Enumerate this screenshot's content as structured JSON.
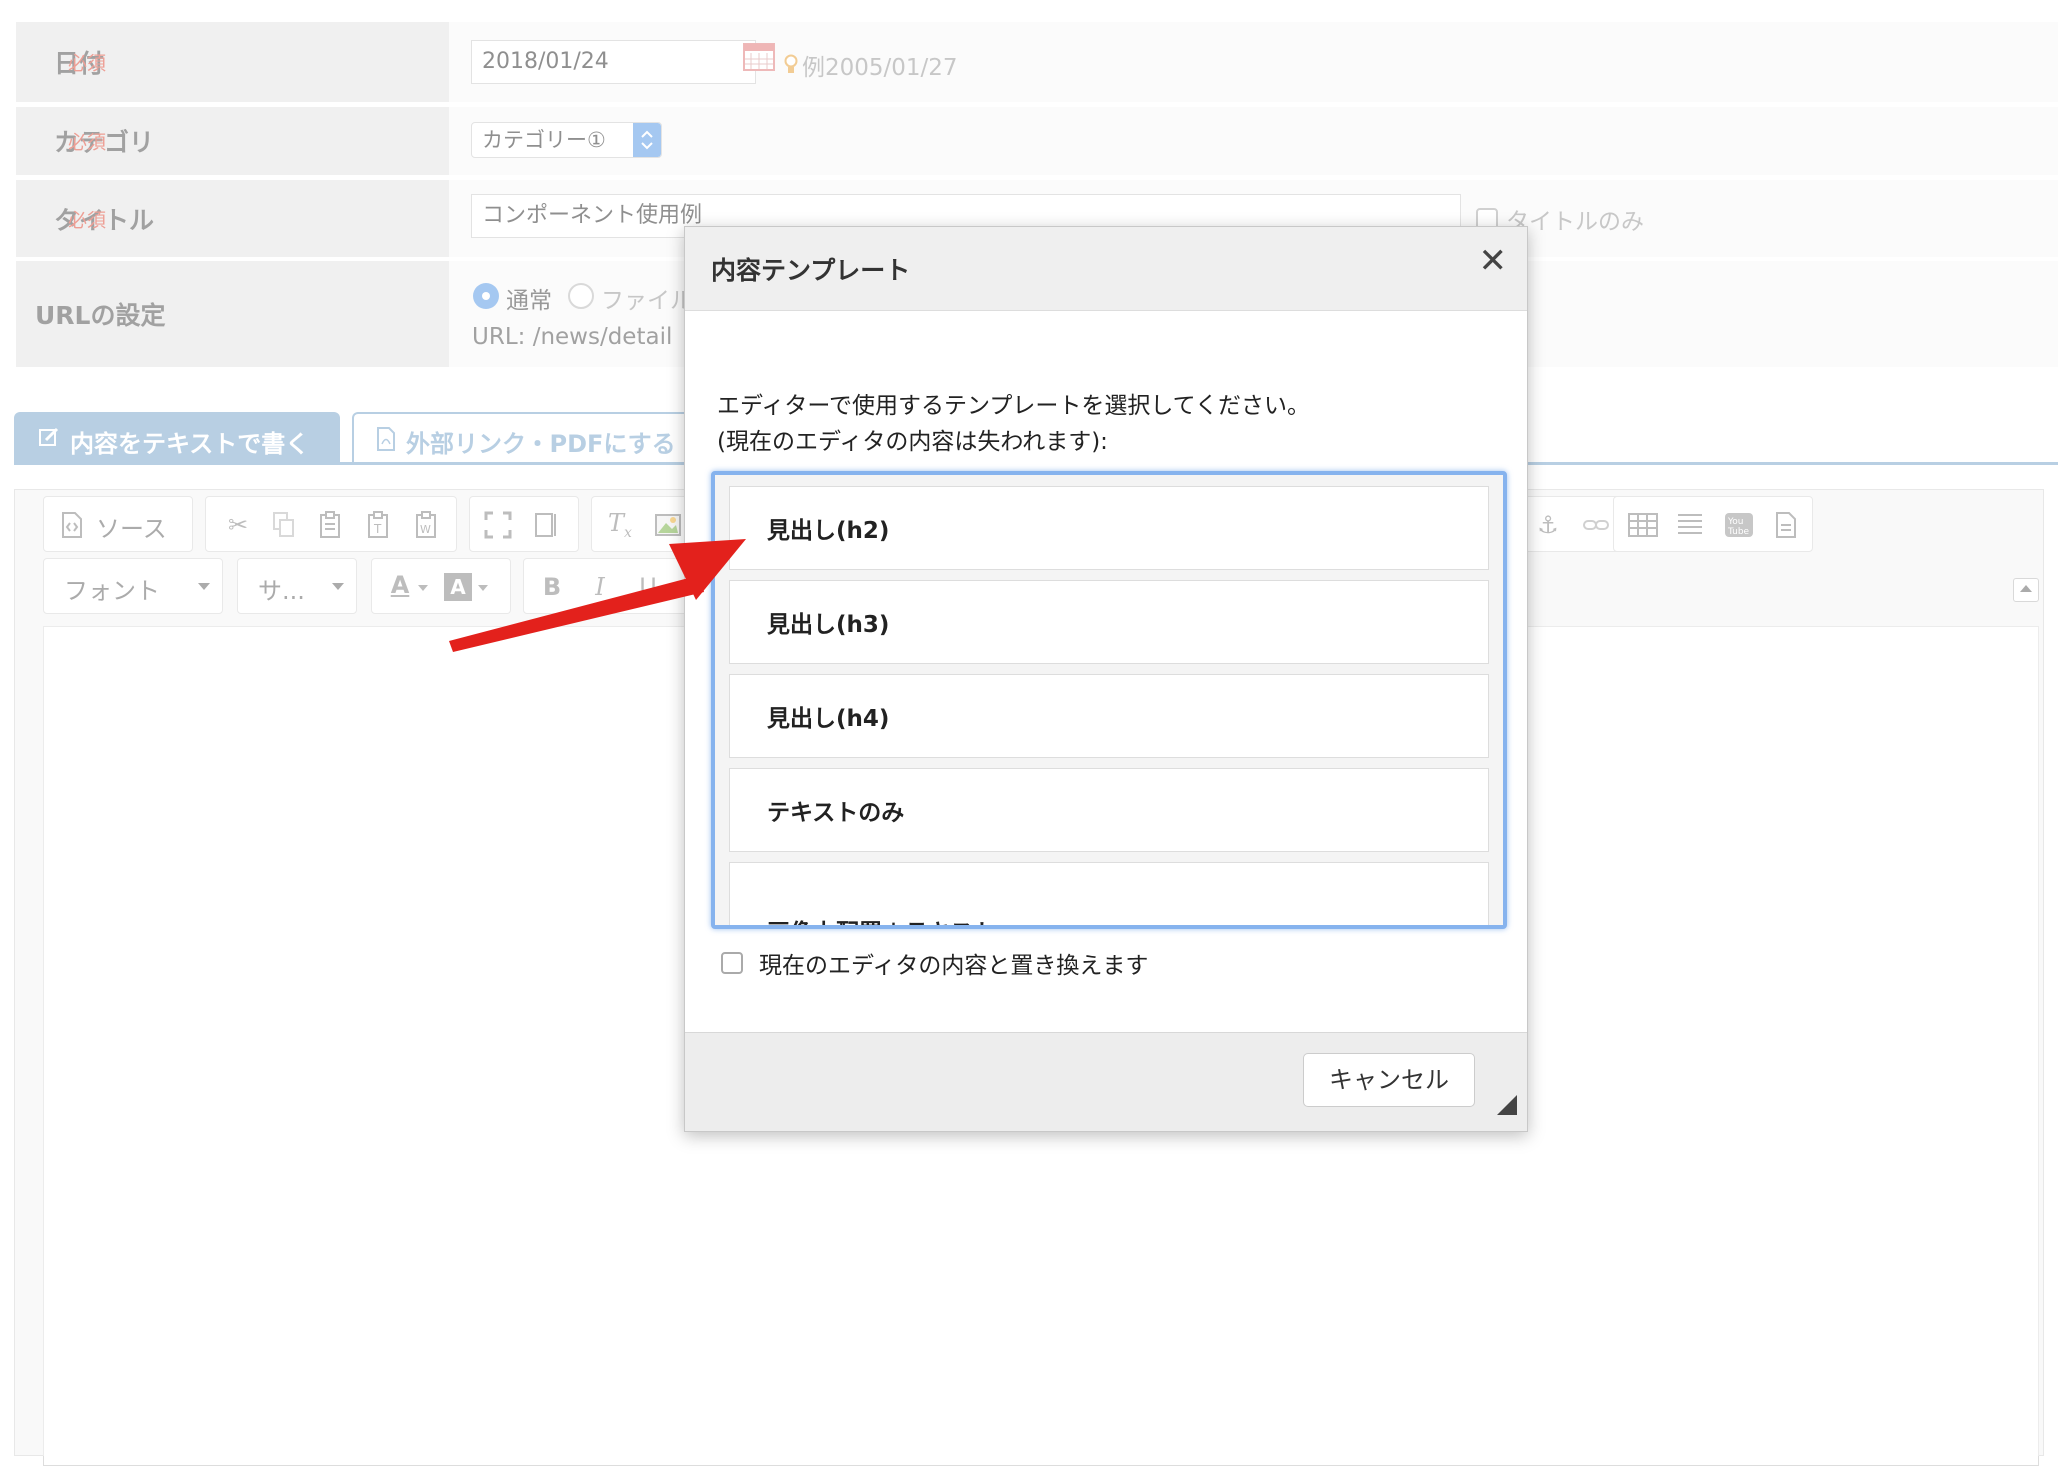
{
  "form": {
    "date": {
      "label": "日付",
      "required": "必須",
      "value": "2018/01/24",
      "hint": "例2005/01/27"
    },
    "category": {
      "label": "カテゴリ",
      "required": "必須",
      "value": "カテゴリー①"
    },
    "title": {
      "label": "タイトル",
      "required": "必須",
      "value": "コンポーネント使用例",
      "title_only": "タイトルのみ"
    },
    "url": {
      "label": "URLの設定",
      "option_normal": "通常",
      "option_file": "ファイル",
      "url_text": "URL: /news/detail"
    }
  },
  "tabs": [
    {
      "label": "内容をテキストで書く",
      "active": true
    },
    {
      "label": "外部リンク・PDFにする",
      "active": false
    }
  ],
  "toolbar": {
    "source_label": "ソース",
    "font_label": "フォント",
    "size_label": "サ..."
  },
  "dialog": {
    "title": "内容テンプレート",
    "close": "✕",
    "instruction_1": "エディターで使用するテンプレートを選択してください。",
    "instruction_2": "(現在のエディタの内容は失われます):",
    "templates": [
      "見出し(h2)",
      "見出し(h3)",
      "見出し(h4)",
      "テキストのみ",
      "画像上配置＋テキスト"
    ],
    "replace_label": "現在のエディタの内容と置き換えます",
    "cancel_label": "キャンセル"
  },
  "colors": {
    "accent": "#7ea8cc",
    "required": "#e0503e",
    "arrow": "#e3211c"
  }
}
